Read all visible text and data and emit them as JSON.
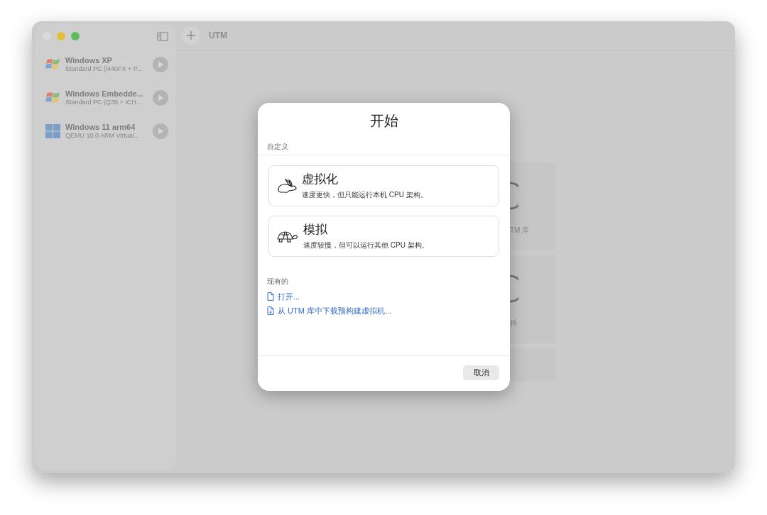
{
  "window": {
    "title": "UTM"
  },
  "sidebar": {
    "items": [
      {
        "name": "Windows XP",
        "subtitle": "Standard PC (i440FX + P...",
        "kind": "flag"
      },
      {
        "name": "Windows Embedde...",
        "subtitle": "Standard PC (Q35 + ICH...",
        "kind": "flag"
      },
      {
        "name": "Windows 11 arm64",
        "subtitle": "QEMU 10.0 ARM Virtual...",
        "kind": "grid"
      }
    ]
  },
  "background_tiles": [
    {
      "kind": "icon-tile",
      "label": "TM 库"
    },
    {
      "kind": "icon-tile",
      "label": "持"
    },
    {
      "kind": "plain"
    }
  ],
  "dialog": {
    "title": "开始",
    "custom": {
      "heading": "自定义",
      "options": [
        {
          "kind": "rabbit",
          "title": "虚拟化",
          "description": "速度更快，但只能运行本机 CPU 架构。"
        },
        {
          "kind": "turtle",
          "title": "模拟",
          "description": "速度较慢，但可以运行其他 CPU 架构。"
        }
      ]
    },
    "existing": {
      "heading": "现有的",
      "links": [
        {
          "kind": "file",
          "label": "打开..."
        },
        {
          "kind": "download",
          "label": "从 UTM 库中下载预构建虚拟机..."
        }
      ]
    },
    "buttons": [
      "取消"
    ]
  }
}
